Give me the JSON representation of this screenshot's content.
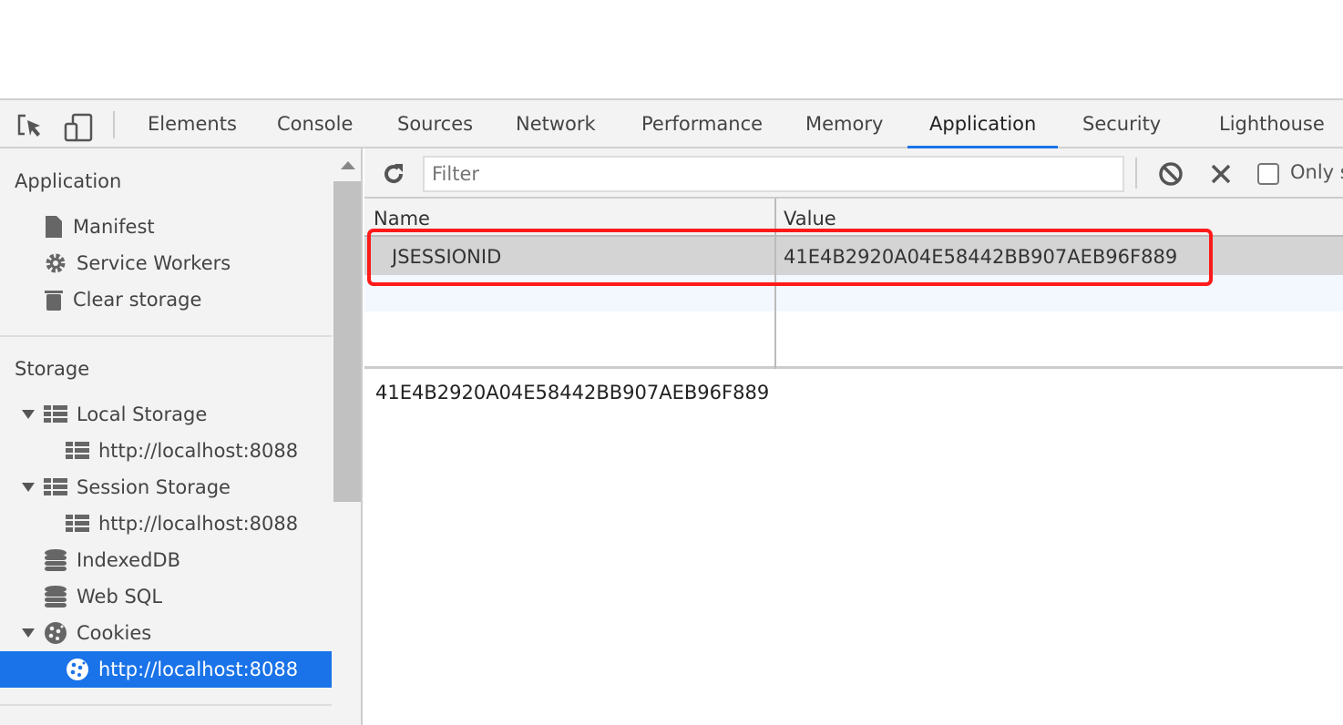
{
  "tabs": [
    {
      "label": "Elements",
      "active": false
    },
    {
      "label": "Console",
      "active": false
    },
    {
      "label": "Sources",
      "active": false
    },
    {
      "label": "Network",
      "active": false
    },
    {
      "label": "Performance",
      "active": false
    },
    {
      "label": "Memory",
      "active": false
    },
    {
      "label": "Application",
      "active": true
    },
    {
      "label": "Security",
      "active": false
    },
    {
      "label": "Lighthouse",
      "active": false
    }
  ],
  "sidebar": {
    "application_heading": "Application",
    "app_items": [
      {
        "label": "Manifest",
        "icon": "file-icon"
      },
      {
        "label": "Service Workers",
        "icon": "gear-icon"
      },
      {
        "label": "Clear storage",
        "icon": "trash-icon"
      }
    ],
    "storage_heading": "Storage",
    "storage_items": [
      {
        "label": "Local Storage",
        "icon": "grid-icon",
        "expanded": true
      },
      {
        "label": "http://localhost:8088",
        "icon": "grid-icon"
      },
      {
        "label": "Session Storage",
        "icon": "grid-icon",
        "expanded": true
      },
      {
        "label": "http://localhost:8088",
        "icon": "grid-icon"
      },
      {
        "label": "IndexedDB",
        "icon": "database-icon"
      },
      {
        "label": "Web SQL",
        "icon": "database-icon"
      },
      {
        "label": "Cookies",
        "icon": "cookie-icon",
        "expanded": true
      },
      {
        "label": "http://localhost:8088",
        "icon": "cookie-icon",
        "selected": true
      }
    ]
  },
  "filterbar": {
    "placeholder": "Filter",
    "only_label": "Only s"
  },
  "table": {
    "columns": [
      "Name",
      "Value"
    ],
    "rows": [
      {
        "name": "JSESSIONID",
        "value": "41E4B2920A04E58442BB907AEB96F889"
      }
    ]
  },
  "preview": "41E4B2920A04E58442BB907AEB96F889",
  "colors": {
    "accent": "#1a73e8",
    "highlight": "#ff1a1a"
  }
}
